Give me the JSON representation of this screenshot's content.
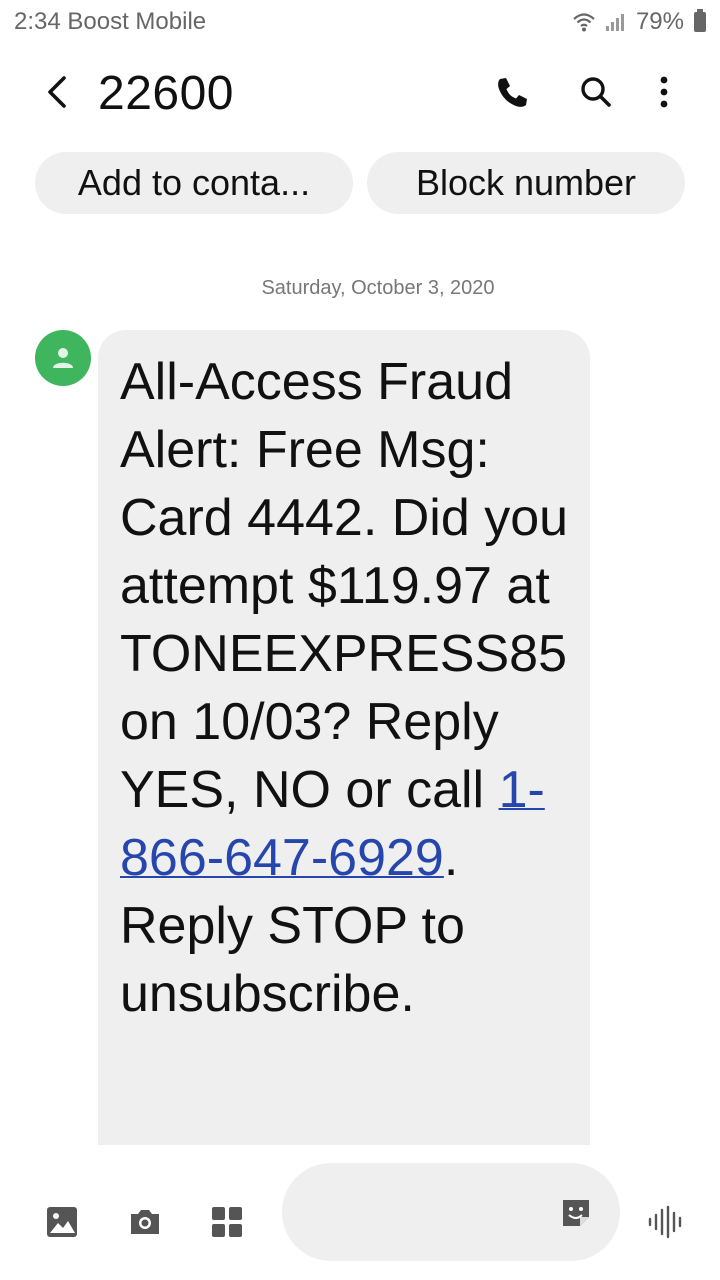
{
  "status_bar": {
    "time": "2:34",
    "carrier": "Boost Mobile",
    "battery": "79%",
    "icons": [
      "wifi-icon",
      "signal-icon",
      "battery-icon"
    ]
  },
  "header": {
    "back_icon": "back-arrow-icon",
    "title": "22600",
    "actions": [
      "phone-icon",
      "search-icon",
      "more-vert-icon"
    ]
  },
  "chips": {
    "add_to_contacts": "Add to conta...",
    "block_number": "Block number"
  },
  "conversation": {
    "date_header": "Saturday, October 3, 2020",
    "messages": [
      {
        "avatar_icon": "person-icon",
        "text_before_link": "All-Access Fraud Alert: Free Msg: Card 4442. Did you attempt $119.97 at TONEEXPRESS85 on 10/03? Reply YES, NO or call ",
        "link": "1-866-647-6929",
        "text_after_link": ". Reply STOP to unsubscribe."
      }
    ]
  },
  "composer": {
    "placeholder": "",
    "icons": [
      "gallery-icon",
      "camera-icon",
      "apps-icon",
      "sticker-icon",
      "voice-icon"
    ]
  },
  "colors": {
    "avatar": "#3fb65e",
    "bubble": "#efefef",
    "link": "#2646ad"
  }
}
